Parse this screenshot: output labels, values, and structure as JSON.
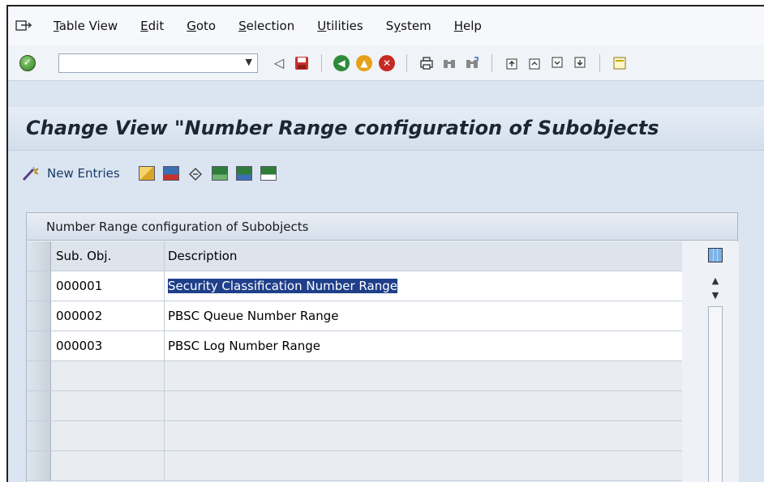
{
  "menubar": {
    "items": [
      {
        "key": "T",
        "rest": "able View"
      },
      {
        "key": "E",
        "rest": "dit"
      },
      {
        "key": "G",
        "rest": "oto"
      },
      {
        "key": "S",
        "rest": "election"
      },
      {
        "key": "U",
        "rest": "tilities"
      },
      {
        "pre": "S",
        "key": "y",
        "rest": "stem"
      },
      {
        "key": "H",
        "rest": "elp"
      }
    ]
  },
  "toolbar": {
    "command_field_value": ""
  },
  "title": "Change View \"Number Range configuration of Subobjects",
  "apptoolbar": {
    "new_entries_label": "New Entries"
  },
  "table": {
    "caption": "Number Range configuration of Subobjects",
    "headers": {
      "sub_obj": "Sub. Obj.",
      "description": "Description"
    },
    "rows": [
      {
        "sub_obj": "000001",
        "description": "Security Classification Number Range"
      },
      {
        "sub_obj": "000002",
        "description": "PBSC Queue Number Range"
      },
      {
        "sub_obj": "000003",
        "description": "PBSC Log Number Range"
      }
    ]
  },
  "colors": {
    "title_bg": "#d3deec",
    "selection_highlight": "#f7c97a",
    "selected_text_bg": "#1f3f8a"
  }
}
